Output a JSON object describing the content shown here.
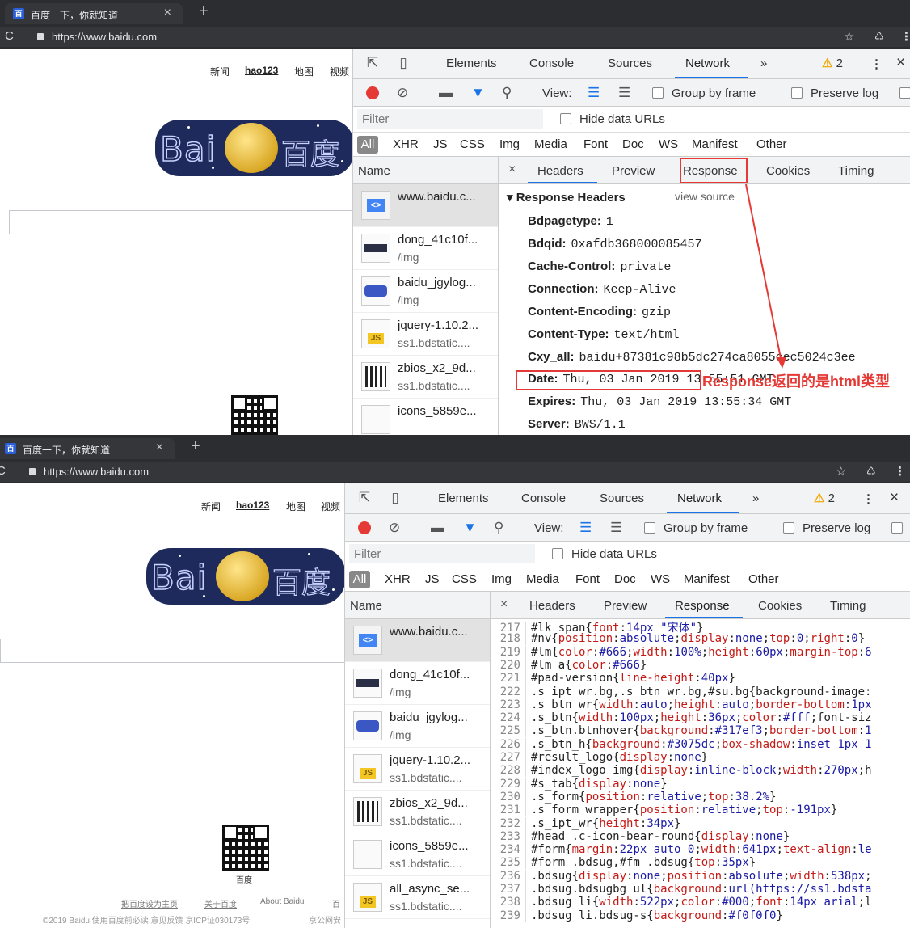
{
  "browser": {
    "tab_title": "百度一下，你就知道",
    "favicon_glyph": "百",
    "close_glyph": "×",
    "new_tab_glyph": "+",
    "url": "https://www.baidu.com",
    "reload_glyph": "C",
    "star_glyph": "☆",
    "ext_glyph": "♺",
    "menu_glyph": "⋮"
  },
  "baidu": {
    "nav": [
      "新闻",
      "hao123",
      "地图",
      "视频"
    ],
    "logo_text": "Bai",
    "logo_cn": "百度",
    "qr_caption": "百度",
    "footer_links": [
      "把百度设为主页",
      "关于百度",
      "About Baidu",
      "百"
    ],
    "footer_copy": "©2019 Baidu 使用百度前必读 意见反馈 京ICP证030173号",
    "footer_police": "京公网安"
  },
  "devtools": {
    "tabs": [
      "Elements",
      "Console",
      "Sources",
      "Network",
      "»"
    ],
    "active_tab": "Network",
    "warn_count": "2",
    "warn_glyph": "⚠",
    "toolbar": {
      "view_label": "View:",
      "group_by_frame": "Group by frame",
      "preserve_log": "Preserve log"
    },
    "filter_placeholder": "Filter",
    "hide_data_urls": "Hide data URLs",
    "type_filters": [
      "All",
      "XHR",
      "JS",
      "CSS",
      "Img",
      "Media",
      "Font",
      "Doc",
      "WS",
      "Manifest",
      "Other"
    ],
    "name_header": "Name",
    "requests": [
      {
        "name": "www.baidu.c...",
        "sub": "",
        "type": "doc"
      },
      {
        "name": "dong_41c10f...",
        "sub": "/img",
        "type": "img1"
      },
      {
        "name": "baidu_jgylog...",
        "sub": "/img",
        "type": "img2"
      },
      {
        "name": "jquery-1.10.2...",
        "sub": "ss1.bdstatic....",
        "type": "js"
      },
      {
        "name": "zbios_x2_9d...",
        "sub": "ss1.bdstatic....",
        "type": "img3"
      },
      {
        "name": "icons_5859e...",
        "sub": "ss1.bdstatic....",
        "type": "blank"
      },
      {
        "name": "all_async_se...",
        "sub": "ss1.bdstatic....",
        "type": "js"
      }
    ],
    "detail_tabs": [
      "Headers",
      "Preview",
      "Response",
      "Cookies",
      "Timing"
    ],
    "detail_close": "×"
  },
  "panel1": {
    "active_detail_tab": "Headers",
    "section_title": "▾ Response Headers",
    "view_source": "view source",
    "headers": [
      {
        "k": "Bdpagetype:",
        "v": "1"
      },
      {
        "k": "Bdqid:",
        "v": "0xafdb368000085457"
      },
      {
        "k": "Cache-Control:",
        "v": "private"
      },
      {
        "k": "Connection:",
        "v": "Keep-Alive"
      },
      {
        "k": "Content-Encoding:",
        "v": "gzip"
      },
      {
        "k": "Content-Type:",
        "v": "text/html"
      },
      {
        "k": "Cxy_all:",
        "v": "baidu+87381c98b5dc274ca8055cec5024c3ee"
      },
      {
        "k": "Date:",
        "v": "Thu, 03 Jan 2019 13:55:51 GMT"
      },
      {
        "k": "Expires:",
        "v": "Thu, 03 Jan 2019 13:55:34 GMT"
      },
      {
        "k": "Server:",
        "v": "BWS/1.1"
      }
    ],
    "annotation": "Response返回的是html类型",
    "annotation_color": "#e53935"
  },
  "panel2": {
    "active_detail_tab": "Response",
    "code_lines": [
      {
        "n": "217",
        "t": "#lk span{font:14px \"宋体\"}"
      },
      {
        "n": "218",
        "t": "#nv{position:absolute;display:none;top:0;right:0}"
      },
      {
        "n": "219",
        "t": "#lm{color:#666;width:100%;height:60px;margin-top:6"
      },
      {
        "n": "220",
        "t": "#lm a{color:#666}"
      },
      {
        "n": "221",
        "t": "#pad-version{line-height:40px}"
      },
      {
        "n": "222",
        "t": ".s_ipt_wr.bg,.s_btn_wr.bg,#su.bg{background-image:"
      },
      {
        "n": "223",
        "t": ".s_btn_wr{width:auto;height:auto;border-bottom:1px"
      },
      {
        "n": "224",
        "t": ".s_btn{width:100px;height:36px;color:#fff;font-siz"
      },
      {
        "n": "225",
        "t": ".s_btn.btnhover{background:#317ef3;border-bottom:1"
      },
      {
        "n": "226",
        "t": ".s_btn_h{background:#3075dc;box-shadow:inset 1px 1"
      },
      {
        "n": "227",
        "t": "#result_logo{display:none}"
      },
      {
        "n": "228",
        "t": "#index_logo img{display:inline-block;width:270px;h"
      },
      {
        "n": "229",
        "t": "#s_tab{display:none}"
      },
      {
        "n": "230",
        "t": ".s_form{position:relative;top:38.2%}"
      },
      {
        "n": "231",
        "t": ".s_form_wrapper{position:relative;top:-191px}"
      },
      {
        "n": "232",
        "t": ".s_ipt_wr{height:34px}"
      },
      {
        "n": "233",
        "t": "#head .c-icon-bear-round{display:none}"
      },
      {
        "n": "234",
        "t": "#form{margin:22px auto 0;width:641px;text-align:le"
      },
      {
        "n": "235",
        "t": "#form .bdsug,#fm .bdsug{top:35px}"
      },
      {
        "n": "236",
        "t": ".bdsug{display:none;position:absolute;width:538px;"
      },
      {
        "n": "237",
        "t": ".bdsug.bdsugbg ul{background:url(https://ss1.bdsta"
      },
      {
        "n": "238",
        "t": ".bdsug li{width:522px;color:#000;font:14px arial;l"
      },
      {
        "n": "239",
        "t": ".bdsug li.bdsug-s{background:#f0f0f0}"
      }
    ]
  }
}
